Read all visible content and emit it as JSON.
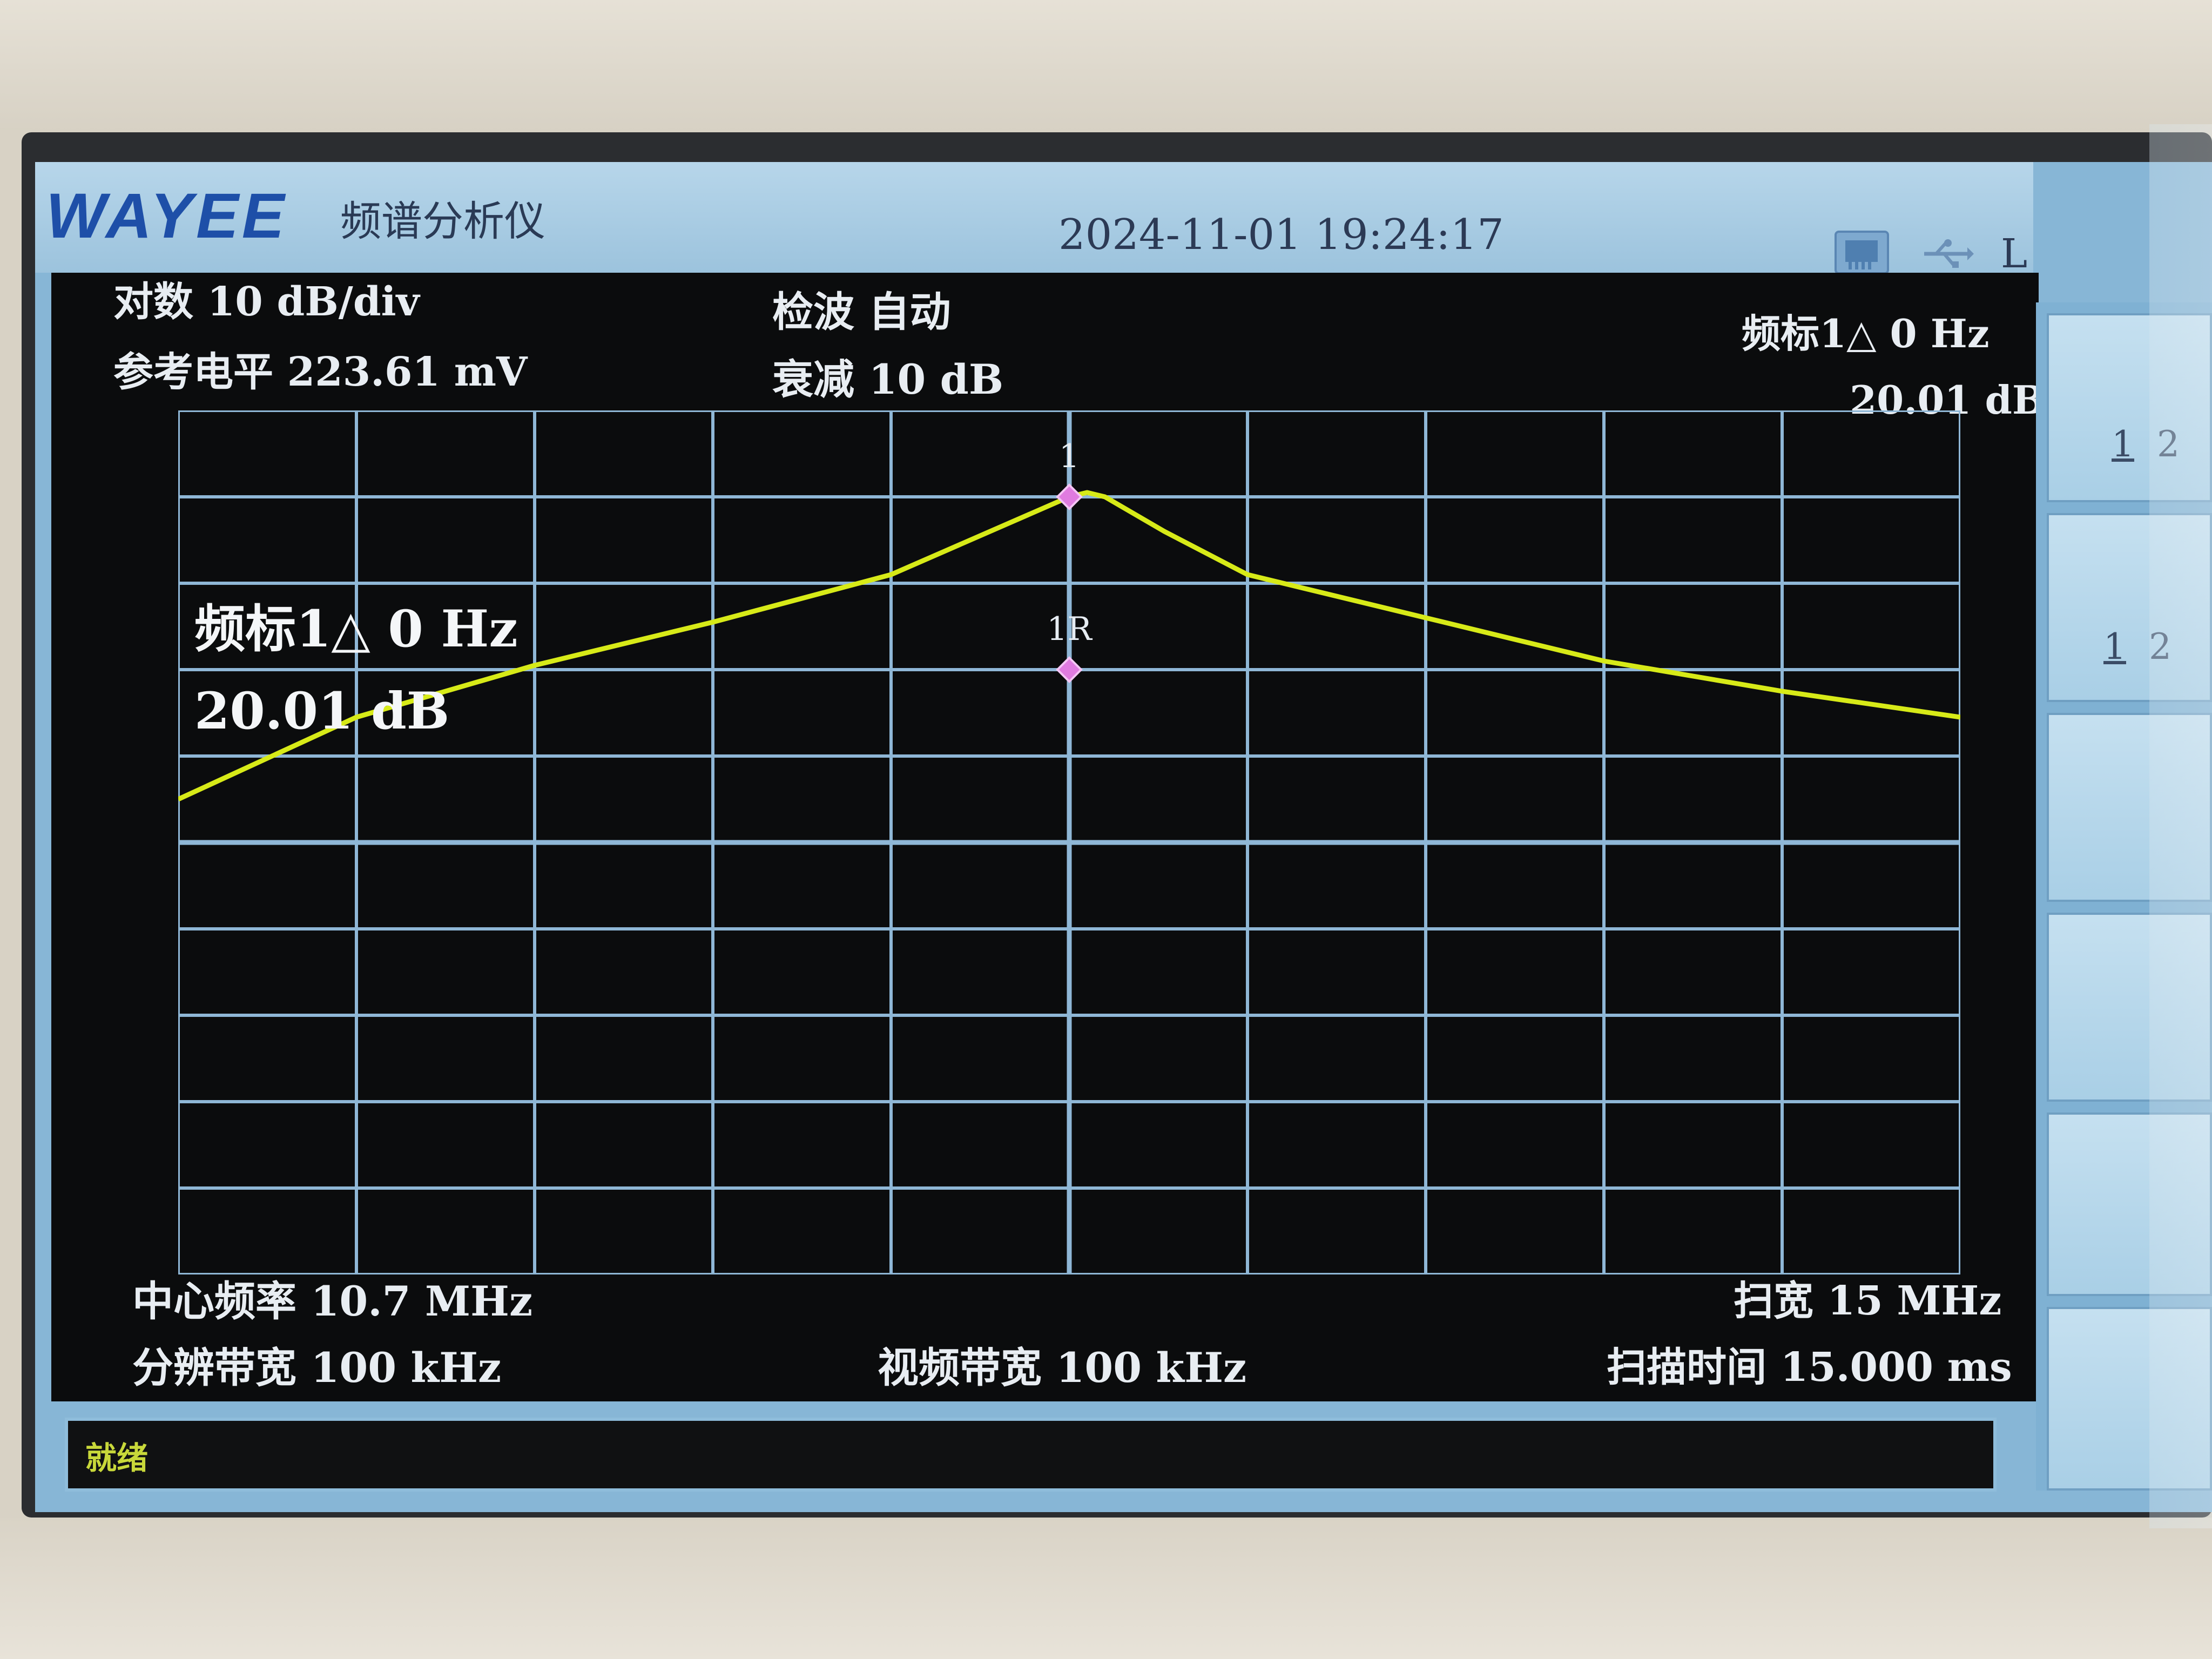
{
  "header": {
    "logo": "WAYEE",
    "title": "频谱分析仪",
    "datetime": "2024-11-01  19:24:17",
    "mode": "L"
  },
  "settings": {
    "scale": "对数  10 dB/div",
    "ref_level": "参考电平  223.61  mV",
    "detector": "检波  自动",
    "attenuation": "衰减  10 dB",
    "marker_delta_label": "频标1△   0 Hz",
    "marker_delta_value": "20.01  dB",
    "center_freq": "中心频率  10.7  MHz",
    "rbw": "分辨带宽  100  kHz",
    "vbw": "视频带宽  100  kHz",
    "span": "扫宽  15  MHz",
    "sweep_time": "扫描时间  15.000  ms"
  },
  "marker_readout": {
    "line1": "频标1△  0 Hz",
    "line2": "20.01  dB",
    "marker1_label": "1",
    "marker1r_label": "1R"
  },
  "status": {
    "text": "就绪"
  },
  "softkeys": [
    {
      "a": "1",
      "b": "2"
    },
    {
      "a": "1",
      "b": "2"
    },
    {
      "a": "",
      "b": ""
    },
    {
      "a": "",
      "b": ""
    },
    {
      "a": "",
      "b": ""
    },
    {
      "a": "",
      "b": ""
    }
  ],
  "colors": {
    "trace": "#d7ea18",
    "grid": "#8fb7d6",
    "marker": "#e07be0",
    "display_bg": "#0b0c0d",
    "frame": "#87b6d6"
  },
  "chart_data": {
    "type": "line",
    "title": "",
    "xlabel": "",
    "ylabel": "",
    "x_unit": "MHz",
    "y_unit": "div",
    "xlim": [
      3.2,
      18.2
    ],
    "ylim": [
      0,
      10
    ],
    "grid": true,
    "x": [
      3.2,
      4.7,
      6.2,
      7.7,
      9.2,
      10.2,
      10.7,
      10.85,
      11.0,
      11.5,
      12.2,
      13.7,
      15.2,
      16.7,
      18.2
    ],
    "y": [
      5.5,
      6.45,
      7.05,
      7.55,
      8.1,
      8.7,
      9.0,
      9.05,
      9.0,
      8.6,
      8.1,
      7.6,
      7.1,
      6.75,
      6.45
    ],
    "markers": [
      {
        "name": "1",
        "x": 10.7,
        "y": 9.0
      },
      {
        "name": "1R",
        "x": 10.7,
        "y": 7.0
      }
    ]
  }
}
